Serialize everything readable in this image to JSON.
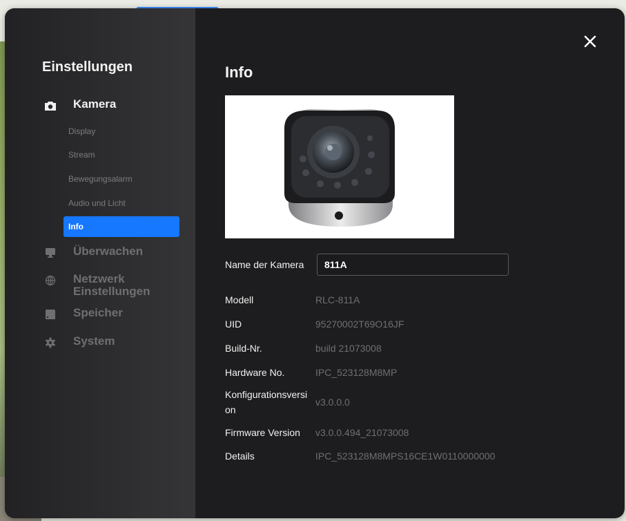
{
  "sidebar": {
    "title": "Einstellungen",
    "kamera": {
      "label": "Kamera",
      "icon": "camera-icon",
      "subitems": [
        "Display",
        "Stream",
        "Bewegungsalarm",
        "Audio und Licht",
        "Info"
      ],
      "active": "Info"
    },
    "items": [
      {
        "label": "Überwachen",
        "icon": "monitor-icon"
      },
      {
        "label": "Netzwerk Einstellungen",
        "icon": "globe-icon"
      },
      {
        "label": "Speicher",
        "icon": "storage-icon"
      },
      {
        "label": "System",
        "icon": "gear-icon"
      }
    ]
  },
  "content": {
    "title": "Info",
    "image": "camera-product-image",
    "name_label": "Name der Kamera",
    "name_value": "811A",
    "fields": [
      {
        "label": "Modell",
        "value": "RLC-811A"
      },
      {
        "label": "UID",
        "value": "95270002T69O16JF"
      },
      {
        "label": "Build-Nr.",
        "value": "build 21073008"
      },
      {
        "label": "Hardware No.",
        "value": "IPC_523128M8MP"
      },
      {
        "label": "Konfigurationsversion",
        "value": "v3.0.0.0"
      },
      {
        "label": "Firmware Version",
        "value": "v3.0.0.494_21073008"
      },
      {
        "label": "Details",
        "value": "IPC_523128M8MPS16CE1W0110000000"
      }
    ]
  },
  "colors": {
    "accent": "#1677ff",
    "background": "#1d1d1f",
    "sidebar": "#2a2a2c"
  },
  "close_icon": "close-icon"
}
